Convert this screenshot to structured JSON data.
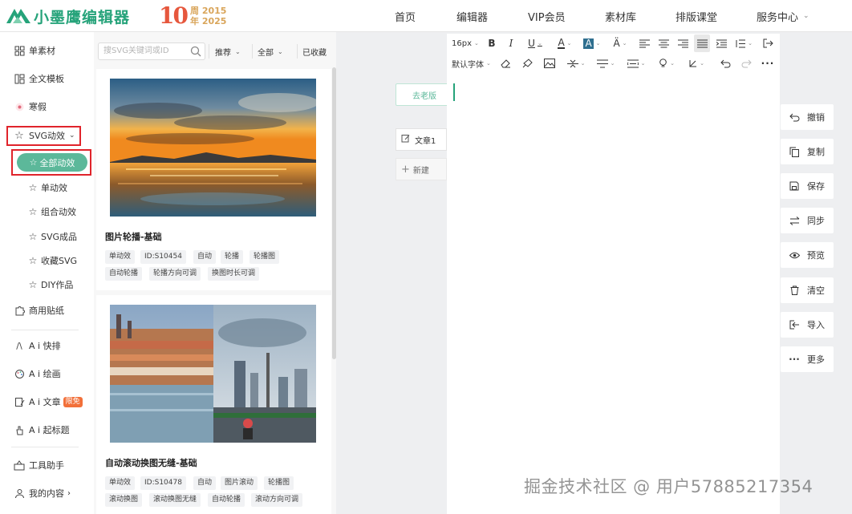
{
  "brand": {
    "name": "小墨鹰编辑器",
    "anniversary_number": "10",
    "anniversary_char_1": "周",
    "anniversary_year_1": "2015",
    "anniversary_char_2": "年",
    "anniversary_year_2": "2025",
    "color": "#26a37a"
  },
  "nav": {
    "items": [
      "首页",
      "编辑器",
      "VIP会员",
      "素材库",
      "排版课堂",
      "服务中心"
    ]
  },
  "sidebar": {
    "material": "单素材",
    "template": "全文模板",
    "vacation": "寒假",
    "svg": "SVG动效",
    "svg_children": {
      "all": "全部动效",
      "single": "单动效",
      "combo": "组合动效",
      "products": "SVG成品",
      "favorites": "收藏SVG",
      "diy": "DIY作品"
    },
    "stickers": "商用贴纸",
    "ai_layout": "A i 快排",
    "ai_paint": "A i 绘画",
    "ai_article": "A i 文章",
    "ai_article_badge": "限免",
    "ai_title": "A i 起标题",
    "tools": "工具助手",
    "my_content": "我的内容"
  },
  "panel": {
    "search_placeholder": "搜SVG关键词或ID",
    "filter_sort": "推荐",
    "filter_scope": "全部",
    "filter_fav": "已收藏",
    "cards": [
      {
        "title": "图片轮播-基础",
        "tags": [
          "单动效",
          "ID:S10454",
          "自动",
          "轮播",
          "轮播图",
          "自动轮播",
          "轮播方向可调",
          "换图时长可调"
        ]
      },
      {
        "title": "自动滚动换图无缝-基础",
        "tags": [
          "单动效",
          "ID:S10478",
          "自动",
          "图片滚动",
          "轮播图",
          "滚动换图",
          "滚动换图无缝",
          "自动轮播",
          "滚动方向可调"
        ]
      }
    ]
  },
  "workspace": {
    "old_version_button": "去老版",
    "doc_tab": "文章1",
    "new_tab": "新建"
  },
  "editor_toolbar": {
    "font_size": "16px",
    "font_family": "默认字体"
  },
  "actions": [
    "撤销",
    "复制",
    "保存",
    "同步",
    "预览",
    "清空",
    "导入",
    "更多"
  ],
  "watermark": "掘金技术社区 @ 用户57885217354",
  "colors": {
    "accent": "#5cb89a",
    "highlight_box": "#e0242b",
    "badge": "#f2703a"
  }
}
